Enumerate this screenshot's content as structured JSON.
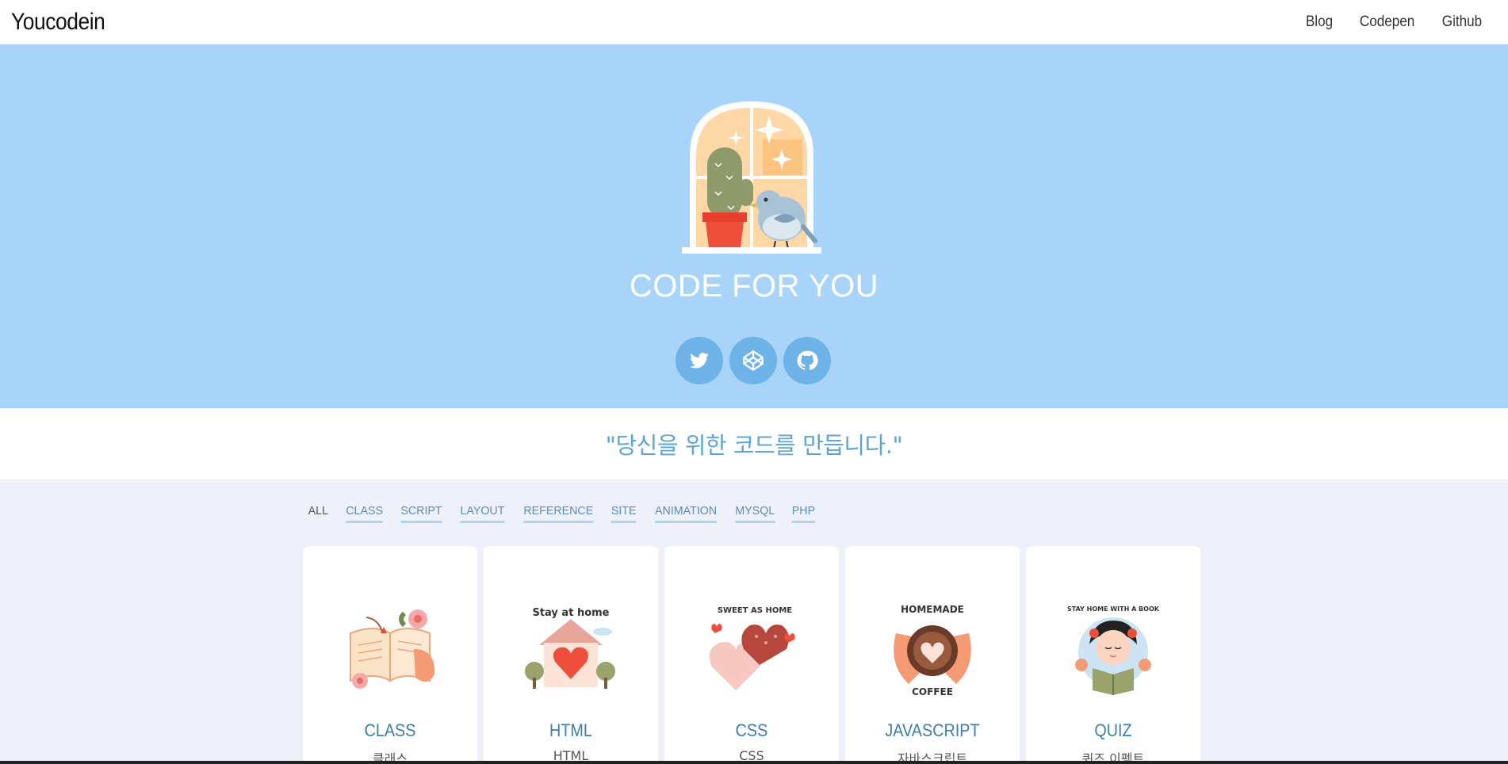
{
  "header": {
    "brand": "Youcodein",
    "nav": [
      {
        "label": "Blog"
      },
      {
        "label": "Codepen"
      },
      {
        "label": "Github"
      }
    ]
  },
  "hero": {
    "title": "CODE FOR YOU",
    "social": [
      {
        "icon": "twitter-icon"
      },
      {
        "icon": "codepen-icon"
      },
      {
        "icon": "github-icon"
      }
    ],
    "background": "#a7d4f8"
  },
  "quote": "\"당신을 위한 코드를 만듭니다.\"",
  "filters": [
    {
      "label": "ALL",
      "active": true
    },
    {
      "label": "CLASS"
    },
    {
      "label": "SCRIPT"
    },
    {
      "label": "LAYOUT"
    },
    {
      "label": "REFERENCE"
    },
    {
      "label": "SITE"
    },
    {
      "label": "ANIMATION"
    },
    {
      "label": "MYSQL"
    },
    {
      "label": "PHP"
    }
  ],
  "cards": [
    {
      "title": "CLASS",
      "subtitle": "클래스",
      "illustration": "book-with-flowers-icon"
    },
    {
      "title": "HTML",
      "subtitle": "HTML",
      "illustration": "stay-at-home-house-icon",
      "badge": "Stay at home"
    },
    {
      "title": "CSS",
      "subtitle": "CSS",
      "illustration": "sweet-as-home-heart-icon",
      "badge": "SWEET AS HOME"
    },
    {
      "title": "JAVASCRIPT",
      "subtitle": "자바스크립트",
      "illustration": "homemade-coffee-icon",
      "badge_top": "HOMEMADE",
      "badge_bottom": "COFFEE"
    },
    {
      "title": "QUIZ",
      "subtitle": "퀴즈 이펙트",
      "illustration": "reading-girl-icon",
      "badge": "STAY HOME WITH A BOOK"
    }
  ]
}
